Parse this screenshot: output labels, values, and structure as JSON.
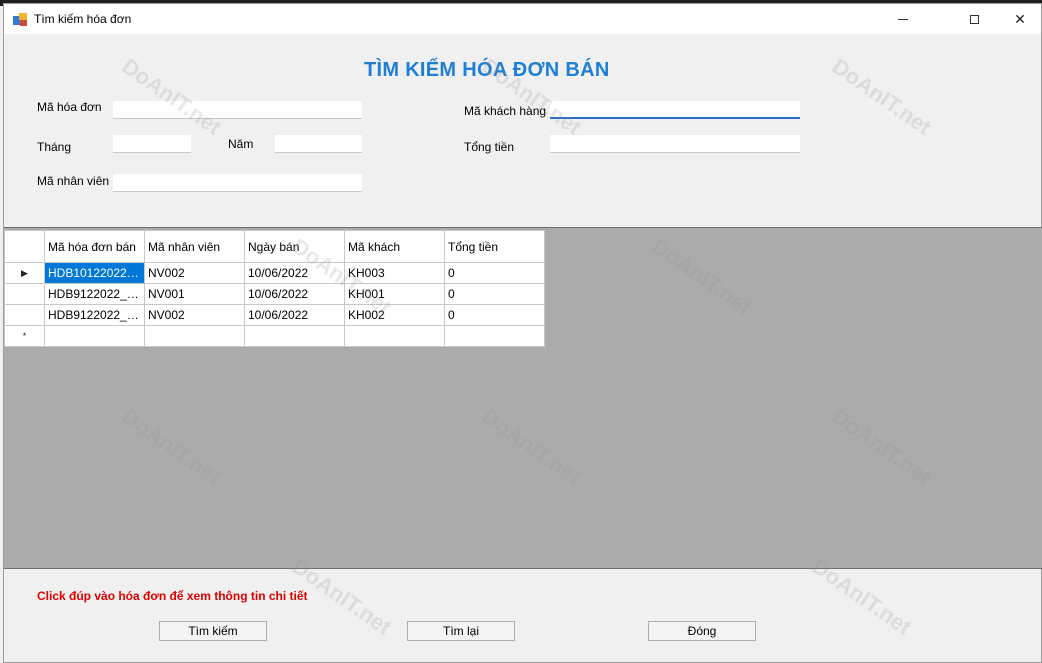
{
  "window": {
    "title": "Tìm kiếm hóa đơn"
  },
  "form": {
    "heading": "TÌM KIẾM HÓA ĐƠN BÁN",
    "fields": {
      "ma_hoa_don": {
        "label": "Mã hóa đơn",
        "value": ""
      },
      "ma_khach_hang": {
        "label": "Mã khách hàng",
        "value": ""
      },
      "thang": {
        "label": "Tháng",
        "value": ""
      },
      "nam": {
        "label": "Năm",
        "value": ""
      },
      "tong_tien": {
        "label": "Tổng tiền",
        "value": ""
      },
      "ma_nhan_vien": {
        "label": "Mã nhân viên",
        "value": ""
      }
    }
  },
  "grid": {
    "columns": [
      "Mã hóa đơn bán",
      "Mã nhân viên",
      "Ngày bán",
      "Mã khách",
      "Tổng tiền"
    ],
    "rows": [
      [
        "HDB10122022_1...",
        "NV002",
        "10/06/2022",
        "KH003",
        "0"
      ],
      [
        "HDB9122022_14...",
        "NV001",
        "10/06/2022",
        "KH001",
        "0"
      ],
      [
        "HDB9122022_15...",
        "NV002",
        "10/06/2022",
        "KH002",
        "0"
      ]
    ],
    "current_row_marker": "▶",
    "new_row_marker": "*"
  },
  "hint": "Click đúp vào hóa đơn để xem thông tin chi tiết",
  "buttons": {
    "search": "Tìm kiếm",
    "reset": "Tìm lại",
    "close": "Đóng"
  },
  "watermark": "DoAnIT.net",
  "colors": {
    "heading": "#1f7fd6",
    "hint": "#e00000",
    "selection": "#0078d7"
  }
}
